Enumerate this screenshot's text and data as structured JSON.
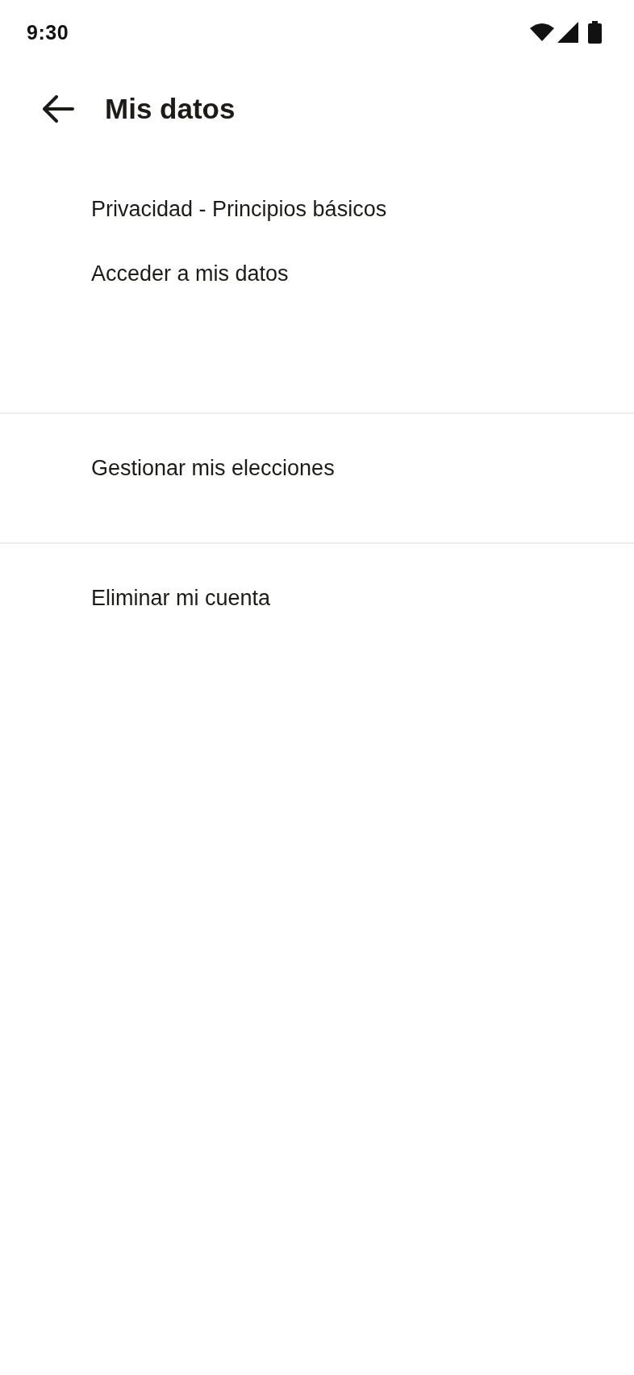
{
  "status_bar": {
    "time": "9:30"
  },
  "app_bar": {
    "title": "Mis datos"
  },
  "sections": [
    {
      "items": [
        "Privacidad - Principios básicos",
        "Acceder a mis datos"
      ]
    },
    {
      "items": [
        "Gestionar mis elecciones"
      ]
    },
    {
      "items": [
        "Eliminar mi cuenta"
      ]
    }
  ]
}
